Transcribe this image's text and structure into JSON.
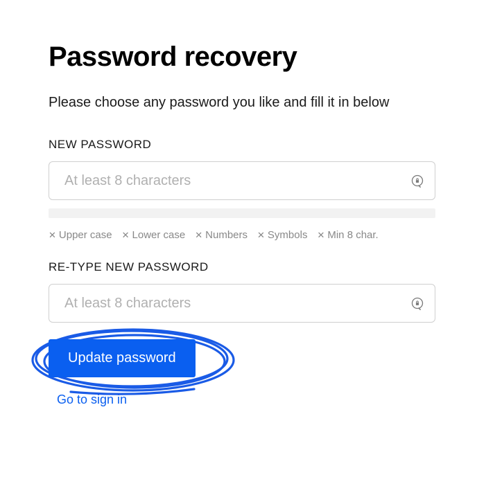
{
  "title": "Password recovery",
  "instruction": "Please choose any password you like and fill it in below",
  "fields": {
    "new_password": {
      "label": "NEW PASSWORD",
      "placeholder": "At least 8 characters"
    },
    "retype_password": {
      "label": "RE-TYPE NEW PASSWORD",
      "placeholder": "At least 8 characters"
    }
  },
  "rules": {
    "upper": "Upper case",
    "lower": "Lower case",
    "numbers": "Numbers",
    "symbols": "Symbols",
    "min": "Min 8 char."
  },
  "buttons": {
    "update": "Update password"
  },
  "links": {
    "signin": "Go to sign in"
  }
}
